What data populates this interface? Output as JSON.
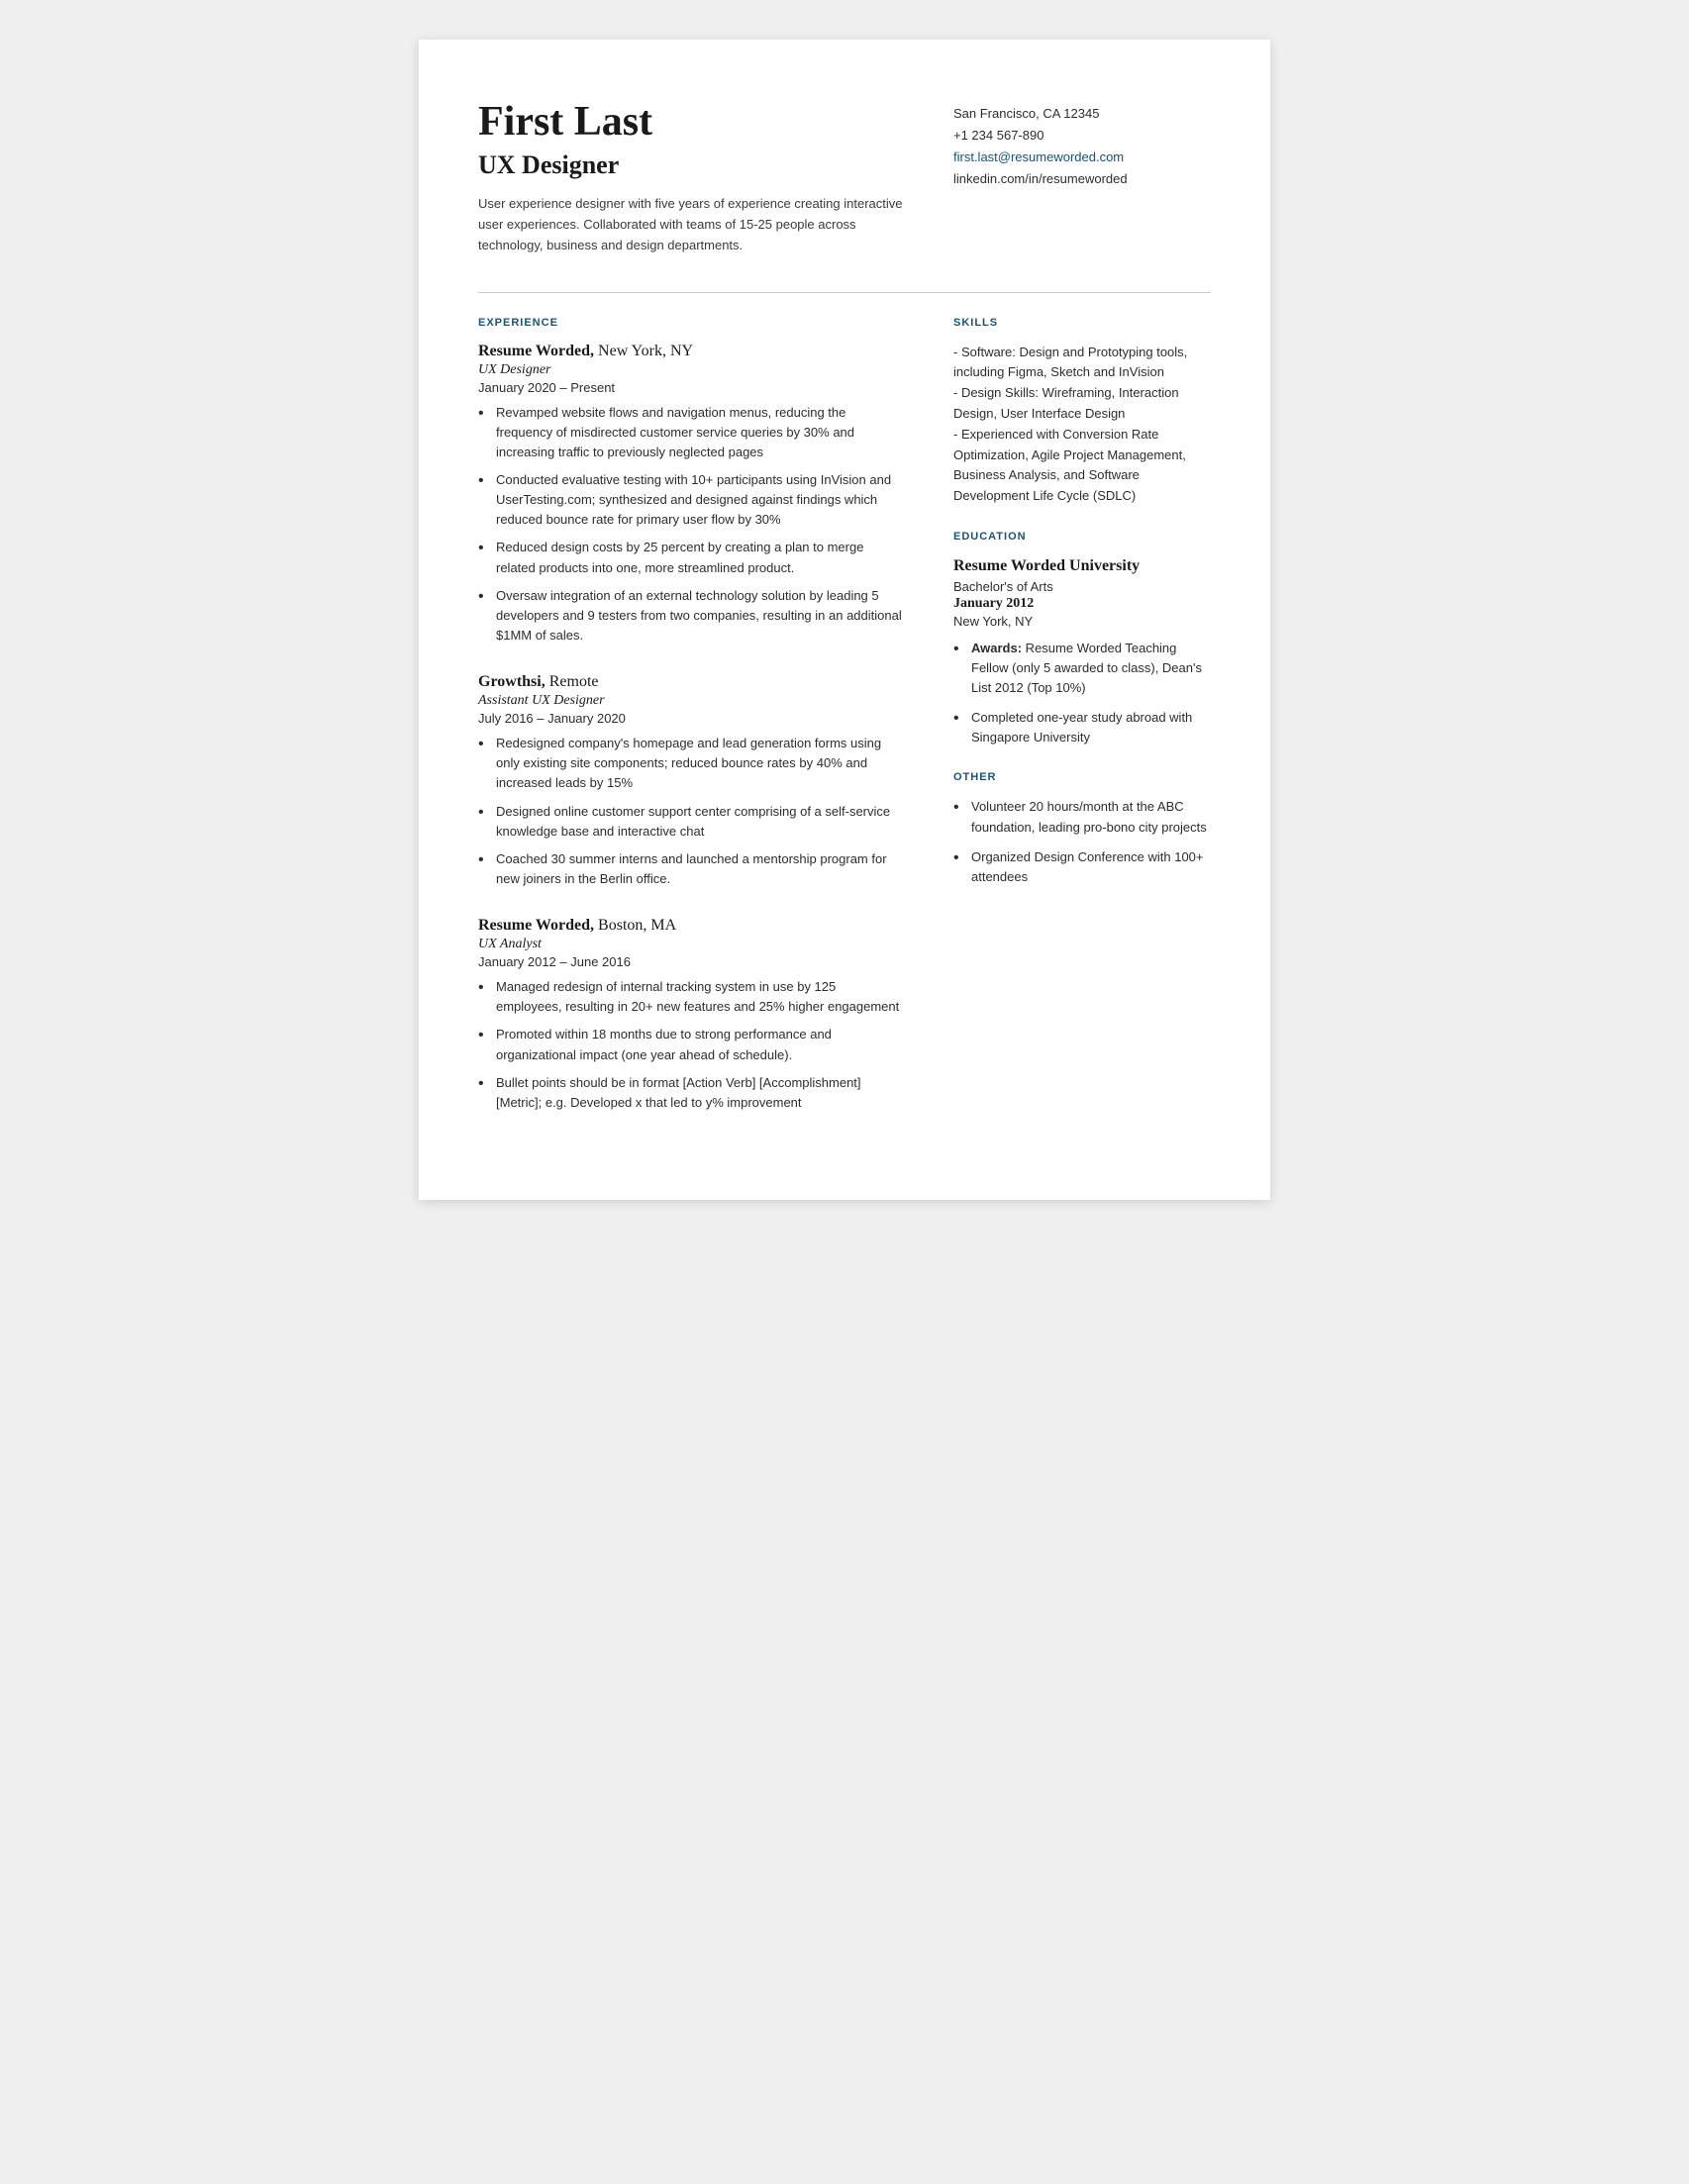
{
  "header": {
    "name": "First Last",
    "title": "UX Designer",
    "summary": "User experience designer with five years of experience creating interactive user experiences. Collaborated with teams of 15-25 people across technology, business and design departments.",
    "contact": {
      "address": "San Francisco, CA 12345",
      "phone": "+1 234 567-890",
      "email": "first.last@resumeworded.com",
      "linkedin": "linkedin.com/in/resumeworded"
    }
  },
  "sections": {
    "experience_heading": "EXPERIENCE",
    "skills_heading": "SKILLS",
    "education_heading": "EDUCATION",
    "other_heading": "OTHER"
  },
  "experience": [
    {
      "company": "Resume Worded,",
      "location": " New York, NY",
      "job_title": "UX Designer",
      "dates": "January 2020 – Present",
      "bullets": [
        "Revamped website flows and navigation menus, reducing the frequency of misdirected customer service queries by 30% and increasing traffic to previously neglected pages",
        "Conducted evaluative testing with 10+ participants using InVision and UserTesting.com; synthesized and designed against findings which reduced bounce rate for primary user flow by 30%",
        "Reduced design costs by 25 percent by creating a plan to merge related products into one, more streamlined product.",
        "Oversaw integration of an external technology solution by leading 5 developers and 9 testers from two companies, resulting in an additional $1MM of sales."
      ]
    },
    {
      "company": "Growthsi,",
      "location": " Remote",
      "job_title": "Assistant UX Designer",
      "dates": "July 2016 – January 2020",
      "bullets": [
        "Redesigned company's homepage and lead generation forms using only existing site components; reduced bounce rates by 40% and increased leads by 15%",
        "Designed online customer support center comprising of a self-service knowledge base and interactive chat",
        "Coached 30 summer interns and launched a mentorship program for new joiners in the Berlin office."
      ]
    },
    {
      "company": "Resume Worded,",
      "location": " Boston, MA",
      "job_title": "UX Analyst",
      "dates": "January 2012 – June 2016",
      "bullets": [
        "Managed redesign of internal tracking system in use by 125 employees, resulting in 20+ new features and 25% higher engagement",
        "Promoted within 18 months due to strong performance and organizational impact (one year ahead of schedule).",
        "Bullet points should be in format [Action Verb] [Accomplishment] [Metric]; e.g. Developed x that led to y% improvement"
      ]
    }
  ],
  "skills": {
    "text": "- Software: Design and Prototyping tools, including Figma, Sketch and InVision\n- Design Skills: Wireframing, Interaction Design, User Interface Design\n- Experienced with Conversion Rate Optimization, Agile Project Management, Business Analysis, and Software Development Life Cycle (SDLC)"
  },
  "education": {
    "school": "Resume Worded University",
    "degree": "Bachelor's of Arts",
    "date": "January 2012",
    "location": "New York, NY",
    "bullets": [
      {
        "label": "Awards:",
        "text": " Resume Worded Teaching Fellow (only 5 awarded to class), Dean's List 2012 (Top 10%)"
      },
      {
        "label": "",
        "text": "Completed one-year study abroad with Singapore University"
      }
    ]
  },
  "other": {
    "bullets": [
      "Volunteer 20 hours/month at the ABC foundation, leading pro-bono city projects",
      "Organized Design Conference with 100+ attendees"
    ]
  }
}
